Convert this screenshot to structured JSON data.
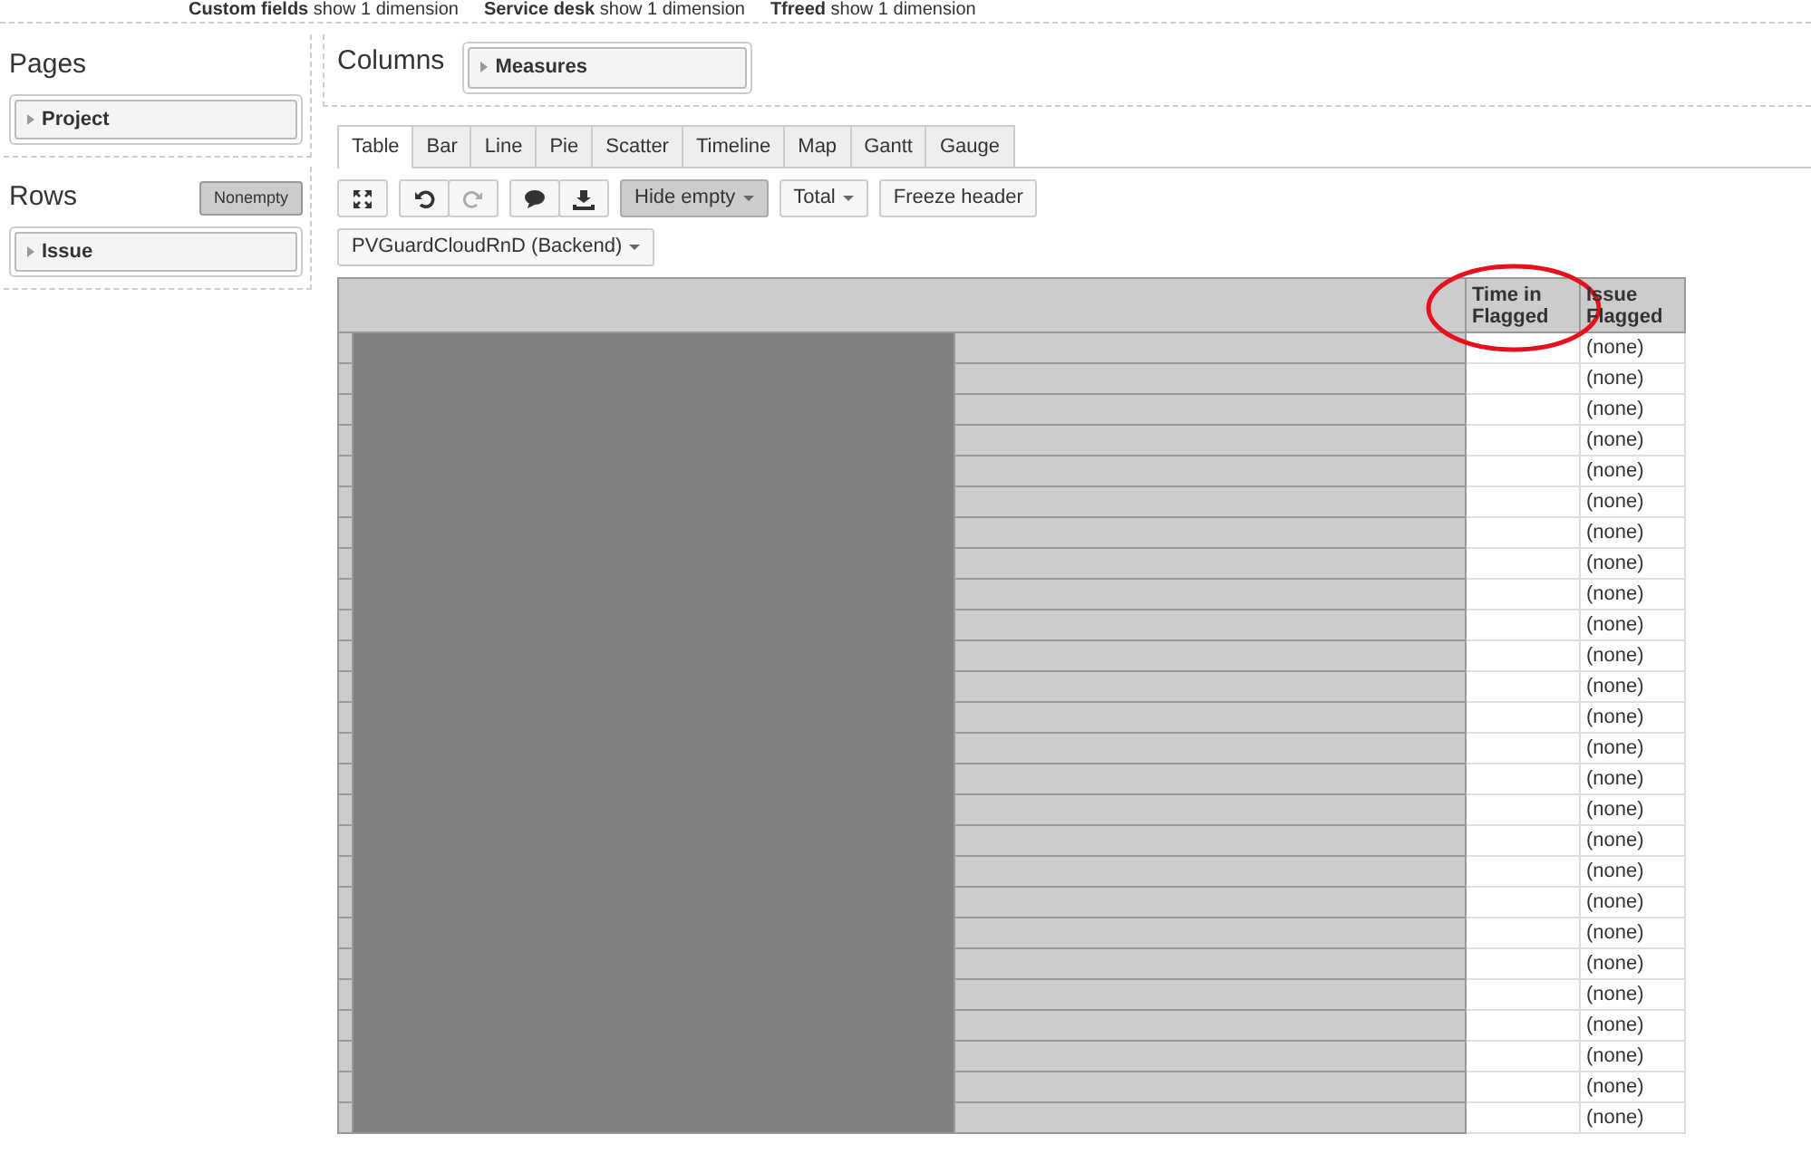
{
  "top_bar": [
    {
      "label": "Custom fields",
      "link": "show 1 dimension"
    },
    {
      "label": "Service desk",
      "link": "show 1 dimension"
    },
    {
      "label": "Tfreed",
      "link": "show 1 dimension"
    }
  ],
  "pages": {
    "title": "Pages",
    "items": [
      {
        "label": "Project"
      }
    ]
  },
  "rows_panel": {
    "title": "Rows",
    "button": {
      "label": "Nonempty",
      "pressed": true
    },
    "items": [
      {
        "label": "Issue"
      }
    ]
  },
  "columns_panel": {
    "title": "Columns",
    "items": [
      {
        "label": "Measures"
      }
    ]
  },
  "tabs": [
    {
      "label": "Table",
      "selected": true
    },
    {
      "label": "Bar",
      "selected": false
    },
    {
      "label": "Line",
      "selected": false
    },
    {
      "label": "Pie",
      "selected": false
    },
    {
      "label": "Scatter",
      "selected": false
    },
    {
      "label": "Timeline",
      "selected": false
    },
    {
      "label": "Map",
      "selected": false
    },
    {
      "label": "Gantt",
      "selected": false
    },
    {
      "label": "Gauge",
      "selected": false
    }
  ],
  "toolbar": [
    [
      {
        "kind": "expand",
        "disabled": false
      }
    ],
    [
      {
        "kind": "undo",
        "disabled": false
      },
      {
        "kind": "redo",
        "disabled": true
      }
    ],
    [
      {
        "kind": "comment",
        "disabled": false
      },
      {
        "kind": "download",
        "disabled": false
      }
    ],
    [
      {
        "kind": "dropdown",
        "label": "Hide empty",
        "pressed": true
      }
    ],
    [
      {
        "kind": "dropdown",
        "label": "Total",
        "pressed": false
      }
    ],
    [
      {
        "kind": "text",
        "label": "Freeze header",
        "pressed": false
      }
    ]
  ],
  "cube_select": {
    "label": "PVGuardCloudRnD (Backend)"
  },
  "table": {
    "redacted": true,
    "columns": [
      {
        "label": "Time in Flagged",
        "highlighted": true
      },
      {
        "label": "Issue Flagged",
        "highlighted": false
      }
    ],
    "rows": [
      {
        "cells": [
          "",
          "(none)"
        ]
      },
      {
        "cells": [
          "",
          "(none)"
        ]
      },
      {
        "cells": [
          "",
          "(none)"
        ]
      },
      {
        "cells": [
          "",
          "(none)"
        ]
      },
      {
        "cells": [
          "",
          "(none)"
        ]
      },
      {
        "cells": [
          "",
          "(none)"
        ]
      },
      {
        "cells": [
          "",
          "(none)"
        ]
      },
      {
        "cells": [
          "",
          "(none)"
        ]
      },
      {
        "cells": [
          "",
          "(none)"
        ]
      },
      {
        "cells": [
          "",
          "(none)"
        ]
      },
      {
        "cells": [
          "",
          "(none)"
        ]
      },
      {
        "cells": [
          "",
          "(none)"
        ]
      },
      {
        "cells": [
          "",
          "(none)"
        ]
      },
      {
        "cells": [
          "",
          "(none)"
        ]
      },
      {
        "cells": [
          "",
          "(none)"
        ]
      },
      {
        "cells": [
          "",
          "(none)"
        ]
      },
      {
        "cells": [
          "",
          "(none)"
        ]
      },
      {
        "cells": [
          "",
          "(none)"
        ]
      },
      {
        "cells": [
          "",
          "(none)"
        ]
      },
      {
        "cells": [
          "",
          "(none)"
        ]
      },
      {
        "cells": [
          "",
          "(none)"
        ]
      },
      {
        "cells": [
          "",
          "(none)"
        ]
      },
      {
        "cells": [
          "",
          "(none)"
        ]
      },
      {
        "cells": [
          "",
          "(none)"
        ]
      },
      {
        "cells": [
          "",
          "(none)"
        ]
      },
      {
        "cells": [
          "",
          "(none)"
        ]
      }
    ]
  }
}
